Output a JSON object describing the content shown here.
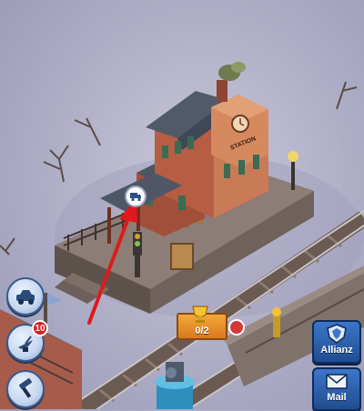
{
  "hud": {
    "left_buttons": [
      {
        "icon": "vehicle-icon"
      },
      {
        "icon": "radar-icon",
        "badge": "10"
      },
      {
        "icon": "hammer-icon"
      }
    ],
    "counter": {
      "value": "0/2",
      "icon": "gold-trophy-icon"
    },
    "alliance_button": {
      "label": "Allianz",
      "icon": "alliance-shield-icon"
    },
    "mail_button": {
      "label": "Mail",
      "icon": "envelope-icon"
    }
  },
  "world": {
    "station_sign": "STATION",
    "station_bubble_icon": "truck-icon",
    "pointer_arrow": "red-arrow-icon"
  },
  "colors": {
    "ground": "#aeadc6",
    "platform": "#7b6e66",
    "station_wall": "#b65d43",
    "station_roof": "#505a69",
    "alert_red": "#d41f1f",
    "ui_blue": "#2f64b3",
    "counter_orange": "#e58a26"
  }
}
